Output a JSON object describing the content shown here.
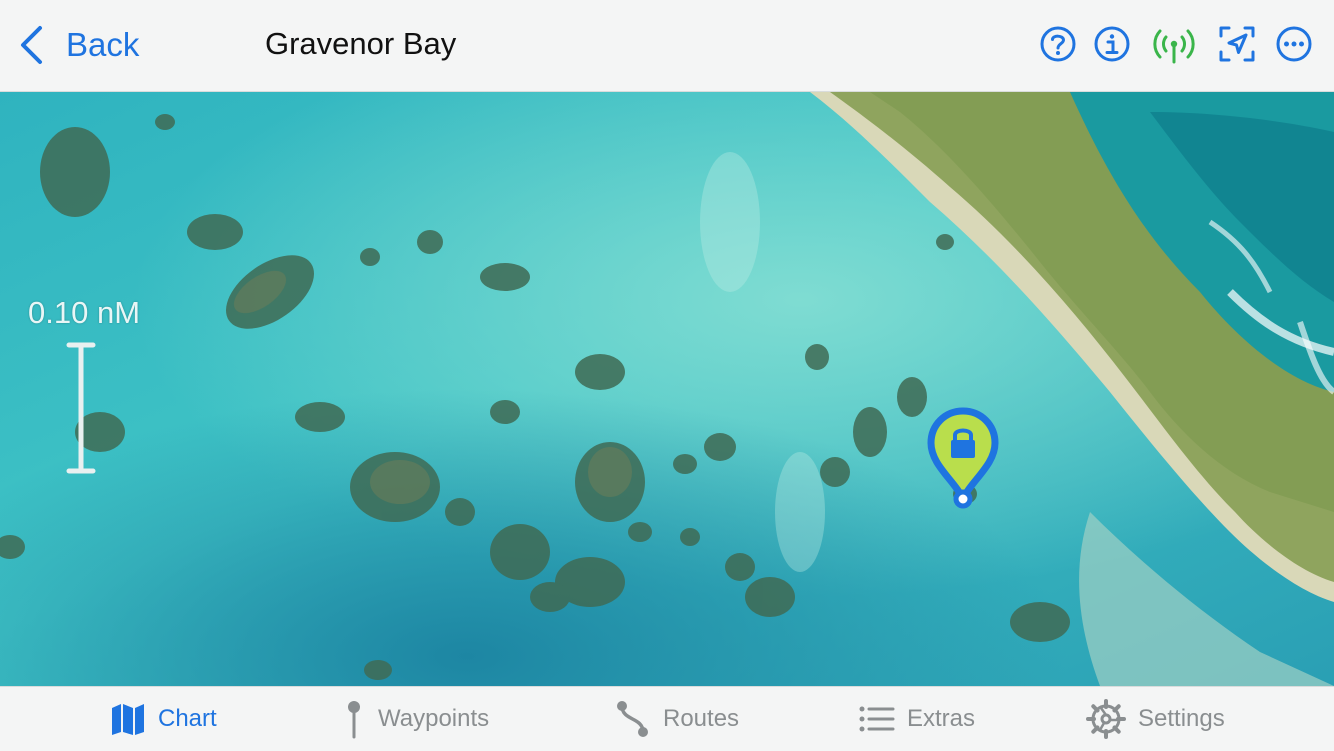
{
  "header": {
    "back_label": "Back",
    "title": "Gravenor Bay",
    "icons": [
      "help-icon",
      "info-icon",
      "gps-signal-icon",
      "recenter-location-icon",
      "more-icon"
    ]
  },
  "map": {
    "scale_label": "0.10 nM",
    "marker": "locked-waypoint-marker"
  },
  "tabbar": {
    "tabs": [
      {
        "label": "Chart",
        "icon": "map-icon",
        "active": true
      },
      {
        "label": "Waypoints",
        "icon": "pin-icon",
        "active": false
      },
      {
        "label": "Routes",
        "icon": "route-icon",
        "active": false
      },
      {
        "label": "Extras",
        "icon": "list-icon",
        "active": false
      },
      {
        "label": "Settings",
        "icon": "gear-icon",
        "active": false
      }
    ]
  },
  "colors": {
    "accent": "#1f74e0",
    "signal_green": "#3ab54a",
    "marker_fill": "#b9de4c",
    "marker_stroke": "#1f74e0",
    "inactive_tab": "#8a8e90"
  }
}
